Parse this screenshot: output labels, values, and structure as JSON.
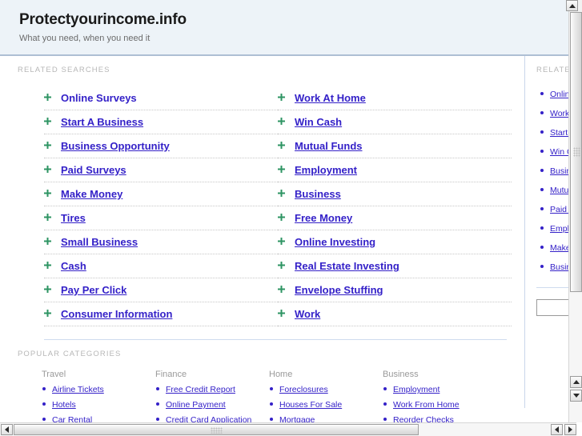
{
  "site": {
    "title": "Protectyourincome.info",
    "tagline": "What you need, when you need it"
  },
  "sections": {
    "related_searches_label": "RELATED SEARCHES",
    "popular_categories_label": "POPULAR CATEGORIES",
    "aside_label": "RELATED"
  },
  "related_searches": {
    "column_left": [
      {
        "label": "Online Surveys",
        "underlined": false
      },
      {
        "label": "Start A Business",
        "underlined": true
      },
      {
        "label": "Business Opportunity",
        "underlined": true
      },
      {
        "label": "Paid Surveys",
        "underlined": true
      },
      {
        "label": "Make Money",
        "underlined": true
      },
      {
        "label": "Tires",
        "underlined": true
      },
      {
        "label": "Small Business",
        "underlined": true
      },
      {
        "label": "Cash",
        "underlined": true
      },
      {
        "label": "Pay Per Click",
        "underlined": true
      },
      {
        "label": "Consumer Information",
        "underlined": true
      }
    ],
    "column_right": [
      {
        "label": "Work At Home",
        "underlined": true
      },
      {
        "label": "Win Cash",
        "underlined": true
      },
      {
        "label": "Mutual Funds",
        "underlined": true
      },
      {
        "label": "Employment",
        "underlined": true
      },
      {
        "label": "Business",
        "underlined": true
      },
      {
        "label": "Free Money",
        "underlined": true
      },
      {
        "label": "Online Investing",
        "underlined": true
      },
      {
        "label": "Real Estate Investing",
        "underlined": true
      },
      {
        "label": "Envelope Stuffing",
        "underlined": true
      },
      {
        "label": "Work",
        "underlined": true
      }
    ]
  },
  "popular_categories": [
    {
      "title": "Travel",
      "links": [
        "Airline Tickets",
        "Hotels",
        "Car Rental"
      ]
    },
    {
      "title": "Finance",
      "links": [
        "Free Credit Report",
        "Online Payment",
        "Credit Card Application"
      ]
    },
    {
      "title": "Home",
      "links": [
        "Foreclosures",
        "Houses For Sale",
        "Mortgage"
      ]
    },
    {
      "title": "Business",
      "links": [
        "Employment",
        "Work From Home",
        "Reorder Checks"
      ]
    }
  ],
  "aside": {
    "links": [
      "Online Surveys",
      "Work At Home",
      "Start A Business",
      "Win Cash",
      "Business Opportunity",
      "Mutual Funds",
      "Paid Surveys",
      "Employment",
      "Make Money",
      "Business"
    ],
    "search_value": "",
    "search_placeholder": ""
  },
  "colors": {
    "link": "#3421c8",
    "marker": "#2e9463",
    "header_bg": "#edf3f8",
    "header_border": "#aebfd4",
    "muted_label": "#b7b7b7"
  },
  "scrollbars": {
    "vertical_up_icon": "triangle-up",
    "vertical_down_icon": "triangle-down",
    "horizontal_left_icon": "triangle-left",
    "horizontal_right_icon": "triangle-right"
  }
}
